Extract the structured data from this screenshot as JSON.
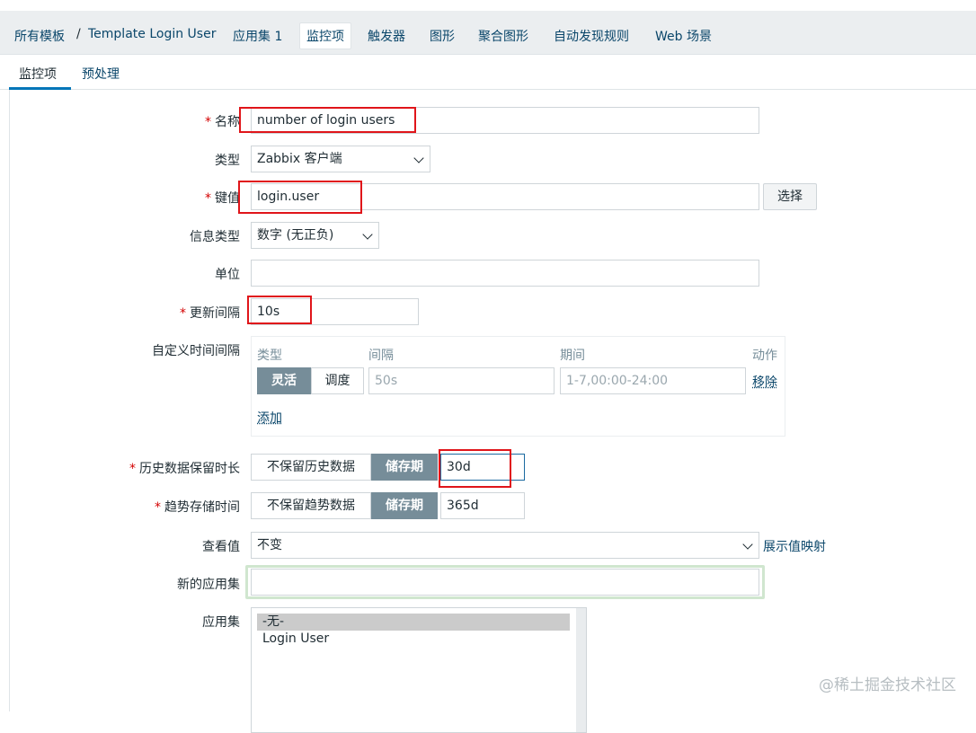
{
  "breadcrumb": {
    "all_templates": "所有模板",
    "separator": "/",
    "template": "Template Login User"
  },
  "nav_tabs": {
    "applications": "应用集 1",
    "items": "监控项",
    "triggers": "触发器",
    "graphs": "图形",
    "screens": "聚合图形",
    "discovery": "自动发现规则",
    "web": "Web 场景"
  },
  "sub_tabs": {
    "item": "监控项",
    "preprocessing": "预处理"
  },
  "form": {
    "name_label": "名称",
    "name_value": "number of login users",
    "type_label": "类型",
    "type_value": "Zabbix 客户端",
    "key_label": "键值",
    "key_value": "login.user",
    "key_select_button": "选择",
    "info_type_label": "信息类型",
    "info_type_value": "数字 (无正负)",
    "units_label": "单位",
    "units_value": "",
    "interval_label": "更新间隔",
    "interval_value": "10s",
    "custom_intervals_label": "自定义时间间隔",
    "custom_intervals": {
      "col_type": "类型",
      "col_interval": "间隔",
      "col_period": "期间",
      "col_action": "动作",
      "flexible": "灵活",
      "scheduling": "调度",
      "interval_placeholder": "50s",
      "period_placeholder": "1-7,00:00-24:00",
      "remove": "移除",
      "add": "添加"
    },
    "history_label": "历史数据保留时长",
    "history_do_not_keep": "不保留历史数据",
    "history_storage_period": "储存期",
    "history_value": "30d",
    "trends_label": "趋势存储时间",
    "trends_do_not_keep": "不保留趋势数据",
    "trends_storage_period": "储存期",
    "trends_value": "365d",
    "show_value_label": "查看值",
    "show_value_value": "不变",
    "show_value_mappings": "展示值映射",
    "new_application_label": "新的应用集",
    "new_application_value": "",
    "applications_label": "应用集",
    "applications_options": [
      "-无-",
      "Login User"
    ]
  },
  "required_marker": "*",
  "watermark": "@稀土掘金技术社区",
  "colors": {
    "link": "#0a466a",
    "required": "#d40000",
    "segment_active": "#768d99",
    "annotation_red": "#e0151a",
    "focus_green": "#d0e6cf"
  }
}
